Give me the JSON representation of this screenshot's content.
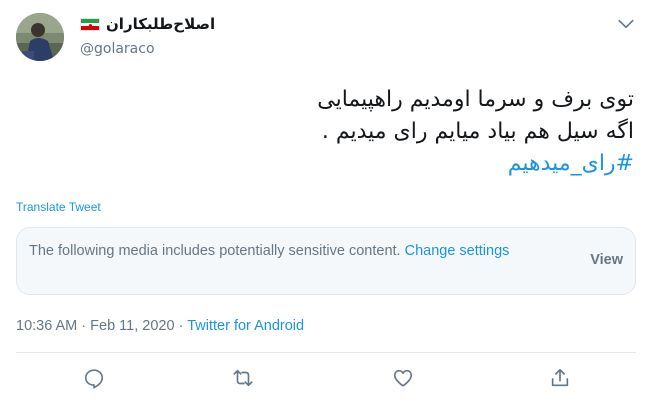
{
  "author": {
    "display_name": "اصلاح‌طلبکاران",
    "handle": "@golaraco"
  },
  "tweet": {
    "lines": [
      "توی برف و سرما اومدیم راهپیمایی",
      "اگه سیل هم بیاد میایم رای میدیم ."
    ],
    "hashtag": "#رای_میدهیم"
  },
  "translate_label": "Translate Tweet",
  "sensitive": {
    "text": "The following media includes potentially sensitive content.",
    "link": "Change settings",
    "view_label": "View"
  },
  "meta": {
    "time": "10:36 AM",
    "separator1": "·",
    "date": "Feb 11, 2020",
    "separator2": "·",
    "source": "Twitter for Android"
  },
  "icons": {
    "more": "chevron-down-icon",
    "reply": "reply-icon",
    "retweet": "retweet-icon",
    "like": "like-icon",
    "share": "share-icon"
  },
  "colors": {
    "accent": "#1b95e0",
    "muted": "#657786",
    "border": "#e1e8ed",
    "flag_green": "#239f40",
    "flag_white": "#ffffff",
    "flag_red": "#da0000"
  }
}
